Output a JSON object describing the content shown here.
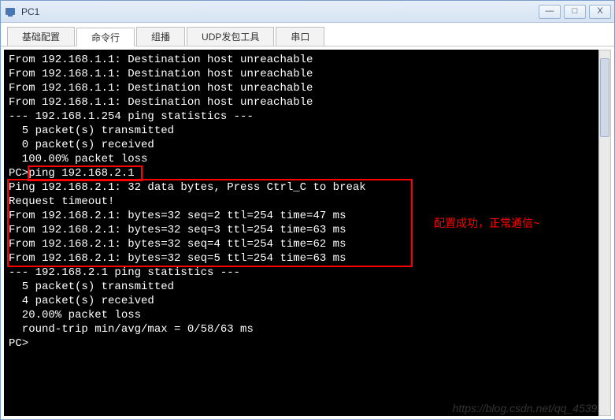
{
  "window": {
    "title": "PC1"
  },
  "tabs": [
    {
      "label": "基础配置",
      "active": false
    },
    {
      "label": "命令行",
      "active": true
    },
    {
      "label": "组播",
      "active": false
    },
    {
      "label": "UDP发包工具",
      "active": false
    },
    {
      "label": "串口",
      "active": false
    }
  ],
  "terminal": {
    "lines_top": [
      "From 192.168.1.1: Destination host unreachable",
      "From 192.168.1.1: Destination host unreachable",
      "From 192.168.1.1: Destination host unreachable",
      "From 192.168.1.1: Destination host unreachable",
      "",
      "--- 192.168.1.254 ping statistics ---",
      "  5 packet(s) transmitted",
      "  0 packet(s) received",
      "  100.00% packet loss",
      ""
    ],
    "cmd_prompt": "PC>",
    "cmd_text": "ping 192.168.2.1",
    "lines_mid_blank": "",
    "ping_block": [
      "Ping 192.168.2.1: 32 data bytes, Press Ctrl_C to break",
      "Request timeout!",
      "From 192.168.2.1: bytes=32 seq=2 ttl=254 time=47 ms",
      "From 192.168.2.1: bytes=32 seq=3 ttl=254 time=63 ms",
      "From 192.168.2.1: bytes=32 seq=4 ttl=254 time=62 ms",
      "From 192.168.2.1: bytes=32 seq=5 ttl=254 time=63 ms"
    ],
    "lines_bottom": [
      "",
      "--- 192.168.2.1 ping statistics ---",
      "  5 packet(s) transmitted",
      "  4 packet(s) received",
      "  20.00% packet loss",
      "  round-trip min/avg/max = 0/58/63 ms",
      "",
      "PC>"
    ]
  },
  "annotation": {
    "text": "配置成功，正常通信~"
  },
  "watermark": "https://blog.csdn.net/qq_4539...",
  "title_buttons": {
    "min": "—",
    "max": "□",
    "close": "X"
  }
}
